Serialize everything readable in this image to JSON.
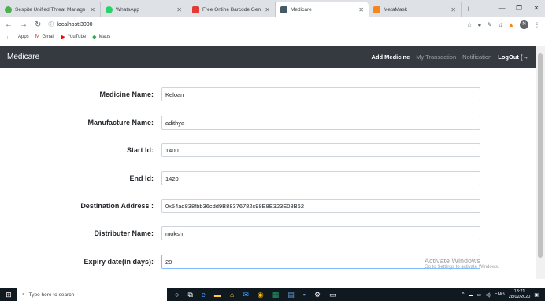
{
  "browser": {
    "tabs": [
      {
        "title": "Sespite Unified Threat Manage",
        "color": "#4caf50"
      },
      {
        "title": "WhatsApp",
        "color": "#25d366"
      },
      {
        "title": "Free Online Barcode Generato",
        "color": "#e53935"
      },
      {
        "title": "Medicare",
        "color": "#455a64"
      },
      {
        "title": "MetaMask",
        "color": "#f6851b"
      }
    ],
    "new_tab": "+",
    "address": "localhost:3000",
    "bookmarks": [
      {
        "label": "Apps",
        "icon": "apps-icon"
      },
      {
        "label": "Gmail",
        "icon": "gmail-icon"
      },
      {
        "label": "YouTube",
        "icon": "youtube-icon"
      },
      {
        "label": "Maps",
        "icon": "maps-icon"
      }
    ],
    "profile_initial": "N"
  },
  "navbar": {
    "brand": "Medicare",
    "links": [
      "Add Medicine",
      "My Transaction",
      "Notification",
      "LogOut"
    ]
  },
  "form": {
    "fields": [
      {
        "label": "Medicine Name:",
        "value": "Keloan"
      },
      {
        "label": "Manufacture Name:",
        "value": "adithya"
      },
      {
        "label": "Start Id:",
        "value": "1400"
      },
      {
        "label": "End Id:",
        "value": "1420"
      },
      {
        "label": "Destination Address :",
        "value": "0x54ad838fbb36cdd9B88376782c98E8E323E08B62"
      },
      {
        "label": "Distributer Name:",
        "value": "moksh"
      },
      {
        "label": "Expiry date(in days):",
        "value": "20"
      }
    ]
  },
  "watermark": {
    "line1": "Activate Windows",
    "line2": "Go to Settings to activate Windows."
  },
  "taskbar": {
    "search_placeholder": "Type here to search",
    "lang": "ENG",
    "time": "13:21",
    "date": "28/02/2020"
  }
}
